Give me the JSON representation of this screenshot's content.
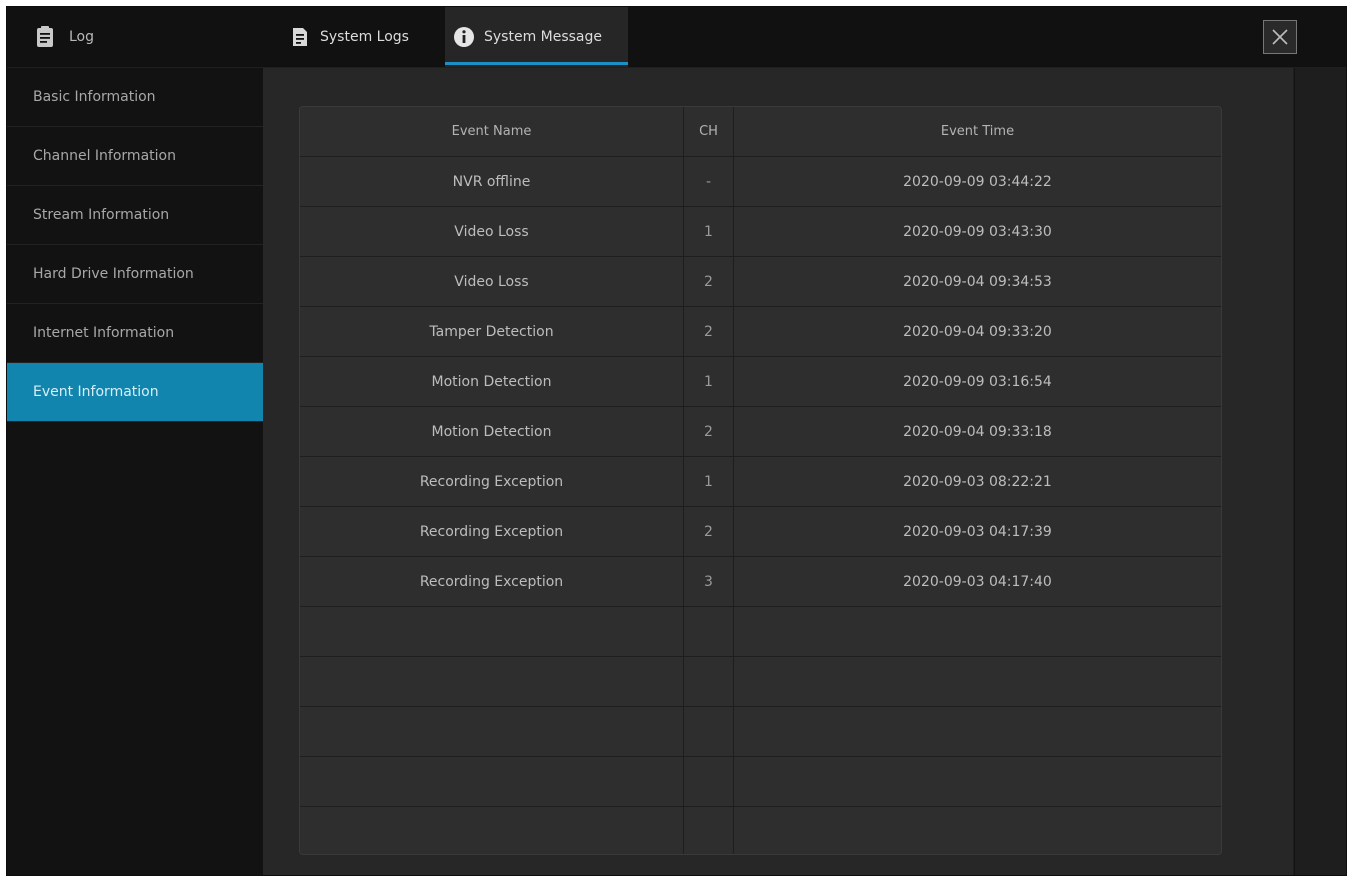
{
  "window": {
    "title": "Log",
    "title_icon": "clipboard-icon",
    "close_icon": "close-icon"
  },
  "tabs": [
    {
      "label": "System Logs",
      "icon": "document-icon",
      "active": false
    },
    {
      "label": "System Message",
      "icon": "info-icon",
      "active": true
    }
  ],
  "sidebar": {
    "items": [
      {
        "label": "Basic Information",
        "active": false
      },
      {
        "label": "Channel Information",
        "active": false
      },
      {
        "label": "Stream Information",
        "active": false
      },
      {
        "label": "Hard Drive Information",
        "active": false
      },
      {
        "label": "Internet Information",
        "active": false
      },
      {
        "label": "Event Information",
        "active": true
      }
    ]
  },
  "table": {
    "columns": [
      "Event Name",
      "CH",
      "Event Time"
    ],
    "rows": [
      {
        "name": "NVR offline",
        "ch": "-",
        "time": "2020-09-09 03:44:22"
      },
      {
        "name": "Video Loss",
        "ch": "1",
        "time": "2020-09-09 03:43:30"
      },
      {
        "name": "Video Loss",
        "ch": "2",
        "time": "2020-09-04 09:34:53"
      },
      {
        "name": "Tamper Detection",
        "ch": "2",
        "time": "2020-09-04 09:33:20"
      },
      {
        "name": "Motion Detection",
        "ch": "1",
        "time": "2020-09-09 03:16:54"
      },
      {
        "name": "Motion Detection",
        "ch": "2",
        "time": "2020-09-04 09:33:18"
      },
      {
        "name": "Recording Exception",
        "ch": "1",
        "time": "2020-09-03 08:22:21"
      },
      {
        "name": "Recording Exception",
        "ch": "2",
        "time": "2020-09-03 04:17:39"
      },
      {
        "name": "Recording Exception",
        "ch": "3",
        "time": "2020-09-03 04:17:40"
      },
      {
        "name": "",
        "ch": "",
        "time": ""
      },
      {
        "name": "",
        "ch": "",
        "time": ""
      },
      {
        "name": "",
        "ch": "",
        "time": ""
      },
      {
        "name": "",
        "ch": "",
        "time": ""
      },
      {
        "name": "",
        "ch": "",
        "time": ""
      }
    ]
  },
  "colors": {
    "accent": "#1285ae",
    "tab_underline": "#1e8fc6",
    "background": "#1f1f1f"
  }
}
